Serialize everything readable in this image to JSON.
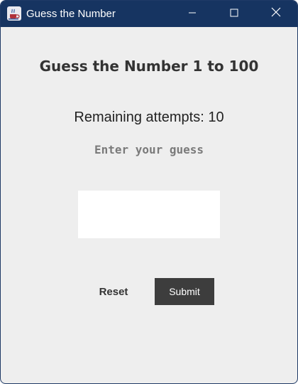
{
  "window": {
    "title": "Guess the Number",
    "icon": "java-coffee-cup-icon",
    "controls": {
      "minimize_icon": "minimize-icon",
      "maximize_icon": "maximize-icon",
      "close_icon": "close-icon"
    }
  },
  "main": {
    "heading": "Guess the Number 1 to 100",
    "attempts_label": "Remaining attempts: 10",
    "prompt": "Enter your guess",
    "guess_input": {
      "value": "",
      "placeholder": ""
    },
    "reset_label": "Reset",
    "submit_label": "Submit"
  },
  "colors": {
    "titlebar": "#163461",
    "background": "#eeeeee",
    "submit_button": "#3d3d3d",
    "prompt_text": "#7a7a7a"
  }
}
